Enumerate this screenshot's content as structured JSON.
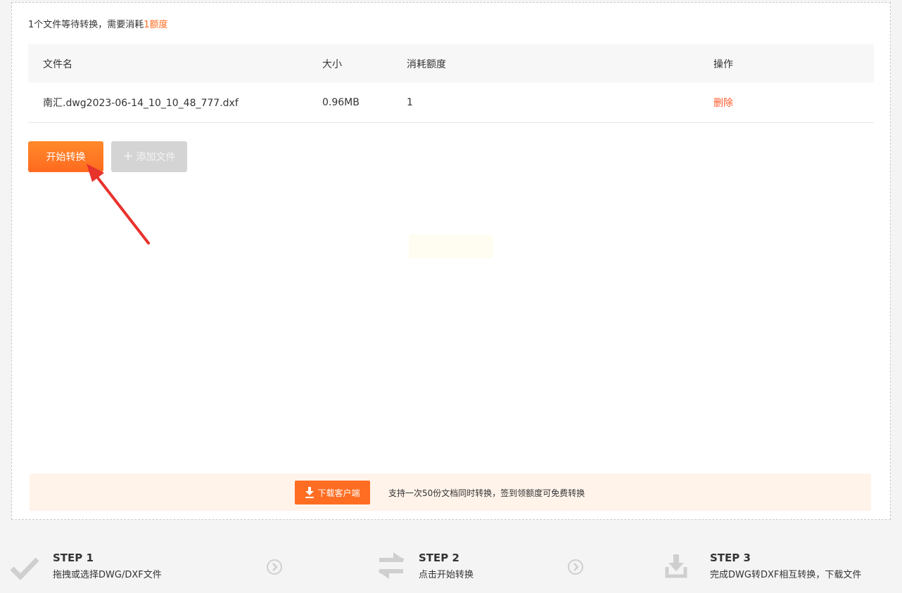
{
  "info": {
    "prefix": "1个文件等待转换，需要消耗",
    "highlight": "1额度"
  },
  "table": {
    "headers": [
      "文件名",
      "大小",
      "消耗额度",
      "操作"
    ],
    "rows": [
      {
        "filename": "南汇.dwg2023-06-14_10_10_48_777.dxf",
        "size": "0.96MB",
        "credits": "1",
        "action": "删除"
      }
    ]
  },
  "buttons": {
    "start_label": "开始转换",
    "add_label": "添加文件"
  },
  "banner": {
    "download_label": "下载客户端",
    "text": "支持一次50份文档同时转换，签到领额度可免费转换"
  },
  "steps": [
    {
      "title": "STEP 1",
      "desc": "拖拽或选择DWG/DXF文件",
      "icon": "checkmark-icon"
    },
    {
      "title": "STEP 2",
      "desc": "点击开始转换",
      "icon": "swap-arrows-icon"
    },
    {
      "title": "STEP 3",
      "desc": "完成DWG转DXF相互转换，下载文件",
      "icon": "download-tray-icon"
    }
  ],
  "colors": {
    "accent": "#ff6a1f",
    "banner_bg": "#fff3ea",
    "annotation_arrow": "#e8322c"
  }
}
